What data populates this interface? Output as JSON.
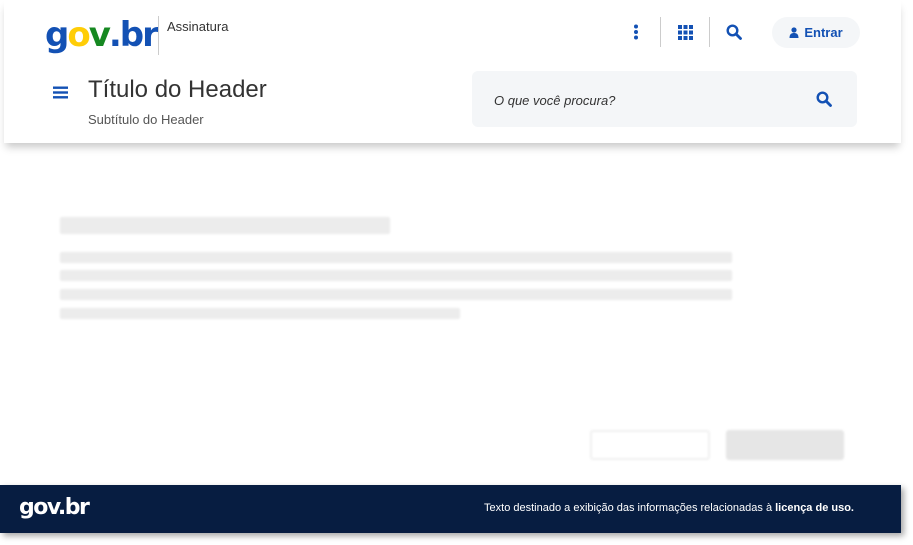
{
  "header": {
    "logo": {
      "g": "g",
      "o": "o",
      "v": "v",
      "dot": ".",
      "b": "b",
      "r": "r"
    },
    "signature": "Assinatura",
    "title": "Título do Header",
    "subtitle": "Subtítulo do Header",
    "login_label": "Entrar",
    "search": {
      "placeholder": "O que você procura?"
    },
    "icons": [
      "more-vertical-icon",
      "apps-grid-icon",
      "search-icon",
      "user-icon",
      "menu-icon"
    ]
  },
  "footer": {
    "logo_text": "gov.br",
    "license_text": "Texto destinado a exibição das informações relacionadas à ",
    "license_link": "licença de uso."
  },
  "colors": {
    "brand_blue": "#1351b4",
    "logo_green": "#168821",
    "logo_yellow": "#ffcd07",
    "footer_bg": "#071d41",
    "search_bg": "#f4f6f8"
  }
}
